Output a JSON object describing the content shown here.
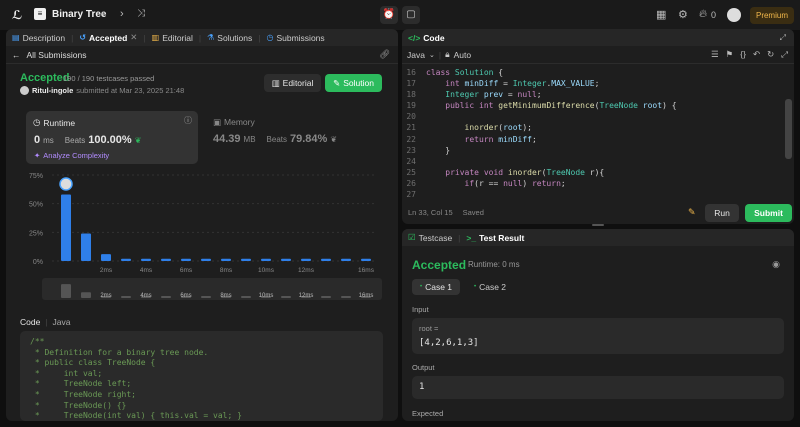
{
  "topbar": {
    "problem_title": "Binary Tree",
    "streak": "0",
    "premium_label": "Premium"
  },
  "left": {
    "tabs": [
      {
        "label": "Description"
      },
      {
        "label": "Accepted"
      },
      {
        "label": "Editorial"
      },
      {
        "label": "Solutions"
      },
      {
        "label": "Submissions"
      }
    ],
    "all_submissions": "All Submissions",
    "status": "Accepted",
    "testcases": "190 / 190 testcases passed",
    "user": "Ritul-ingole",
    "submitted_at": "submitted at Mar 23, 2025 21:48",
    "editorial_btn": "Editorial",
    "solution_btn": "Solution",
    "runtime_label": "Runtime",
    "runtime_value": "0",
    "runtime_unit": "ms",
    "beats_label": "Beats",
    "runtime_beats": "100.00%",
    "analyze": "Analyze Complexity",
    "memory_label": "Memory",
    "memory_value": "44.39",
    "memory_unit": "MB",
    "memory_beats": "79.84%",
    "code_label": "Code",
    "lang_label": "Java",
    "code_lines": [
      "/**",
      " * Definition for a binary tree node.",
      " * public class TreeNode {",
      " *     int val;",
      " *     TreeNode left;",
      " *     TreeNode right;",
      " *     TreeNode() {}",
      " *     TreeNode(int val) { this.val = val; }"
    ]
  },
  "chart_data": {
    "type": "bar",
    "yticks": [
      "75%",
      "50%",
      "25%",
      "0%"
    ],
    "ylim": [
      0,
      75
    ],
    "xticks": [
      "2ms",
      "4ms",
      "6ms",
      "8ms",
      "10ms",
      "12ms",
      "16ms"
    ],
    "values": [
      58,
      24,
      6,
      2,
      2,
      2,
      2,
      2,
      2,
      2,
      2,
      2,
      2,
      2,
      2,
      2
    ],
    "mini_xticks": [
      "2ms",
      "4ms",
      "6ms",
      "8ms",
      "10ms",
      "12ms",
      "16ms"
    ]
  },
  "code_panel": {
    "title": "Code",
    "lang": "Java",
    "auto": "Auto",
    "line_numbers": [
      "16",
      "17",
      "18",
      "19",
      "20",
      "21",
      "22",
      "23",
      "24",
      "25",
      "26",
      "27"
    ],
    "lines": [
      "class Solution {",
      "    int minDiff = Integer.MAX_VALUE;",
      "    Integer prev = null;",
      "    public int getMinimumDifference(TreeNode root) {",
      "",
      "        inorder(root);",
      "        return minDiff;",
      "    }",
      "",
      "    private void inorder(TreeNode r){",
      "        if(r == null) return;",
      ""
    ],
    "position": "Ln 33, Col 15",
    "saved": "Saved",
    "run": "Run",
    "submit": "Submit"
  },
  "result": {
    "tab_testcase": "Testcase",
    "tab_result": "Test Result",
    "status": "Accepted",
    "runtime": "Runtime: 0 ms",
    "case1": "Case 1",
    "case2": "Case 2",
    "input_label": "Input",
    "var_name": "root =",
    "var_value": "[4,2,6,1,3]",
    "output_label": "Output",
    "output_value": "1",
    "expected_label": "Expected"
  }
}
